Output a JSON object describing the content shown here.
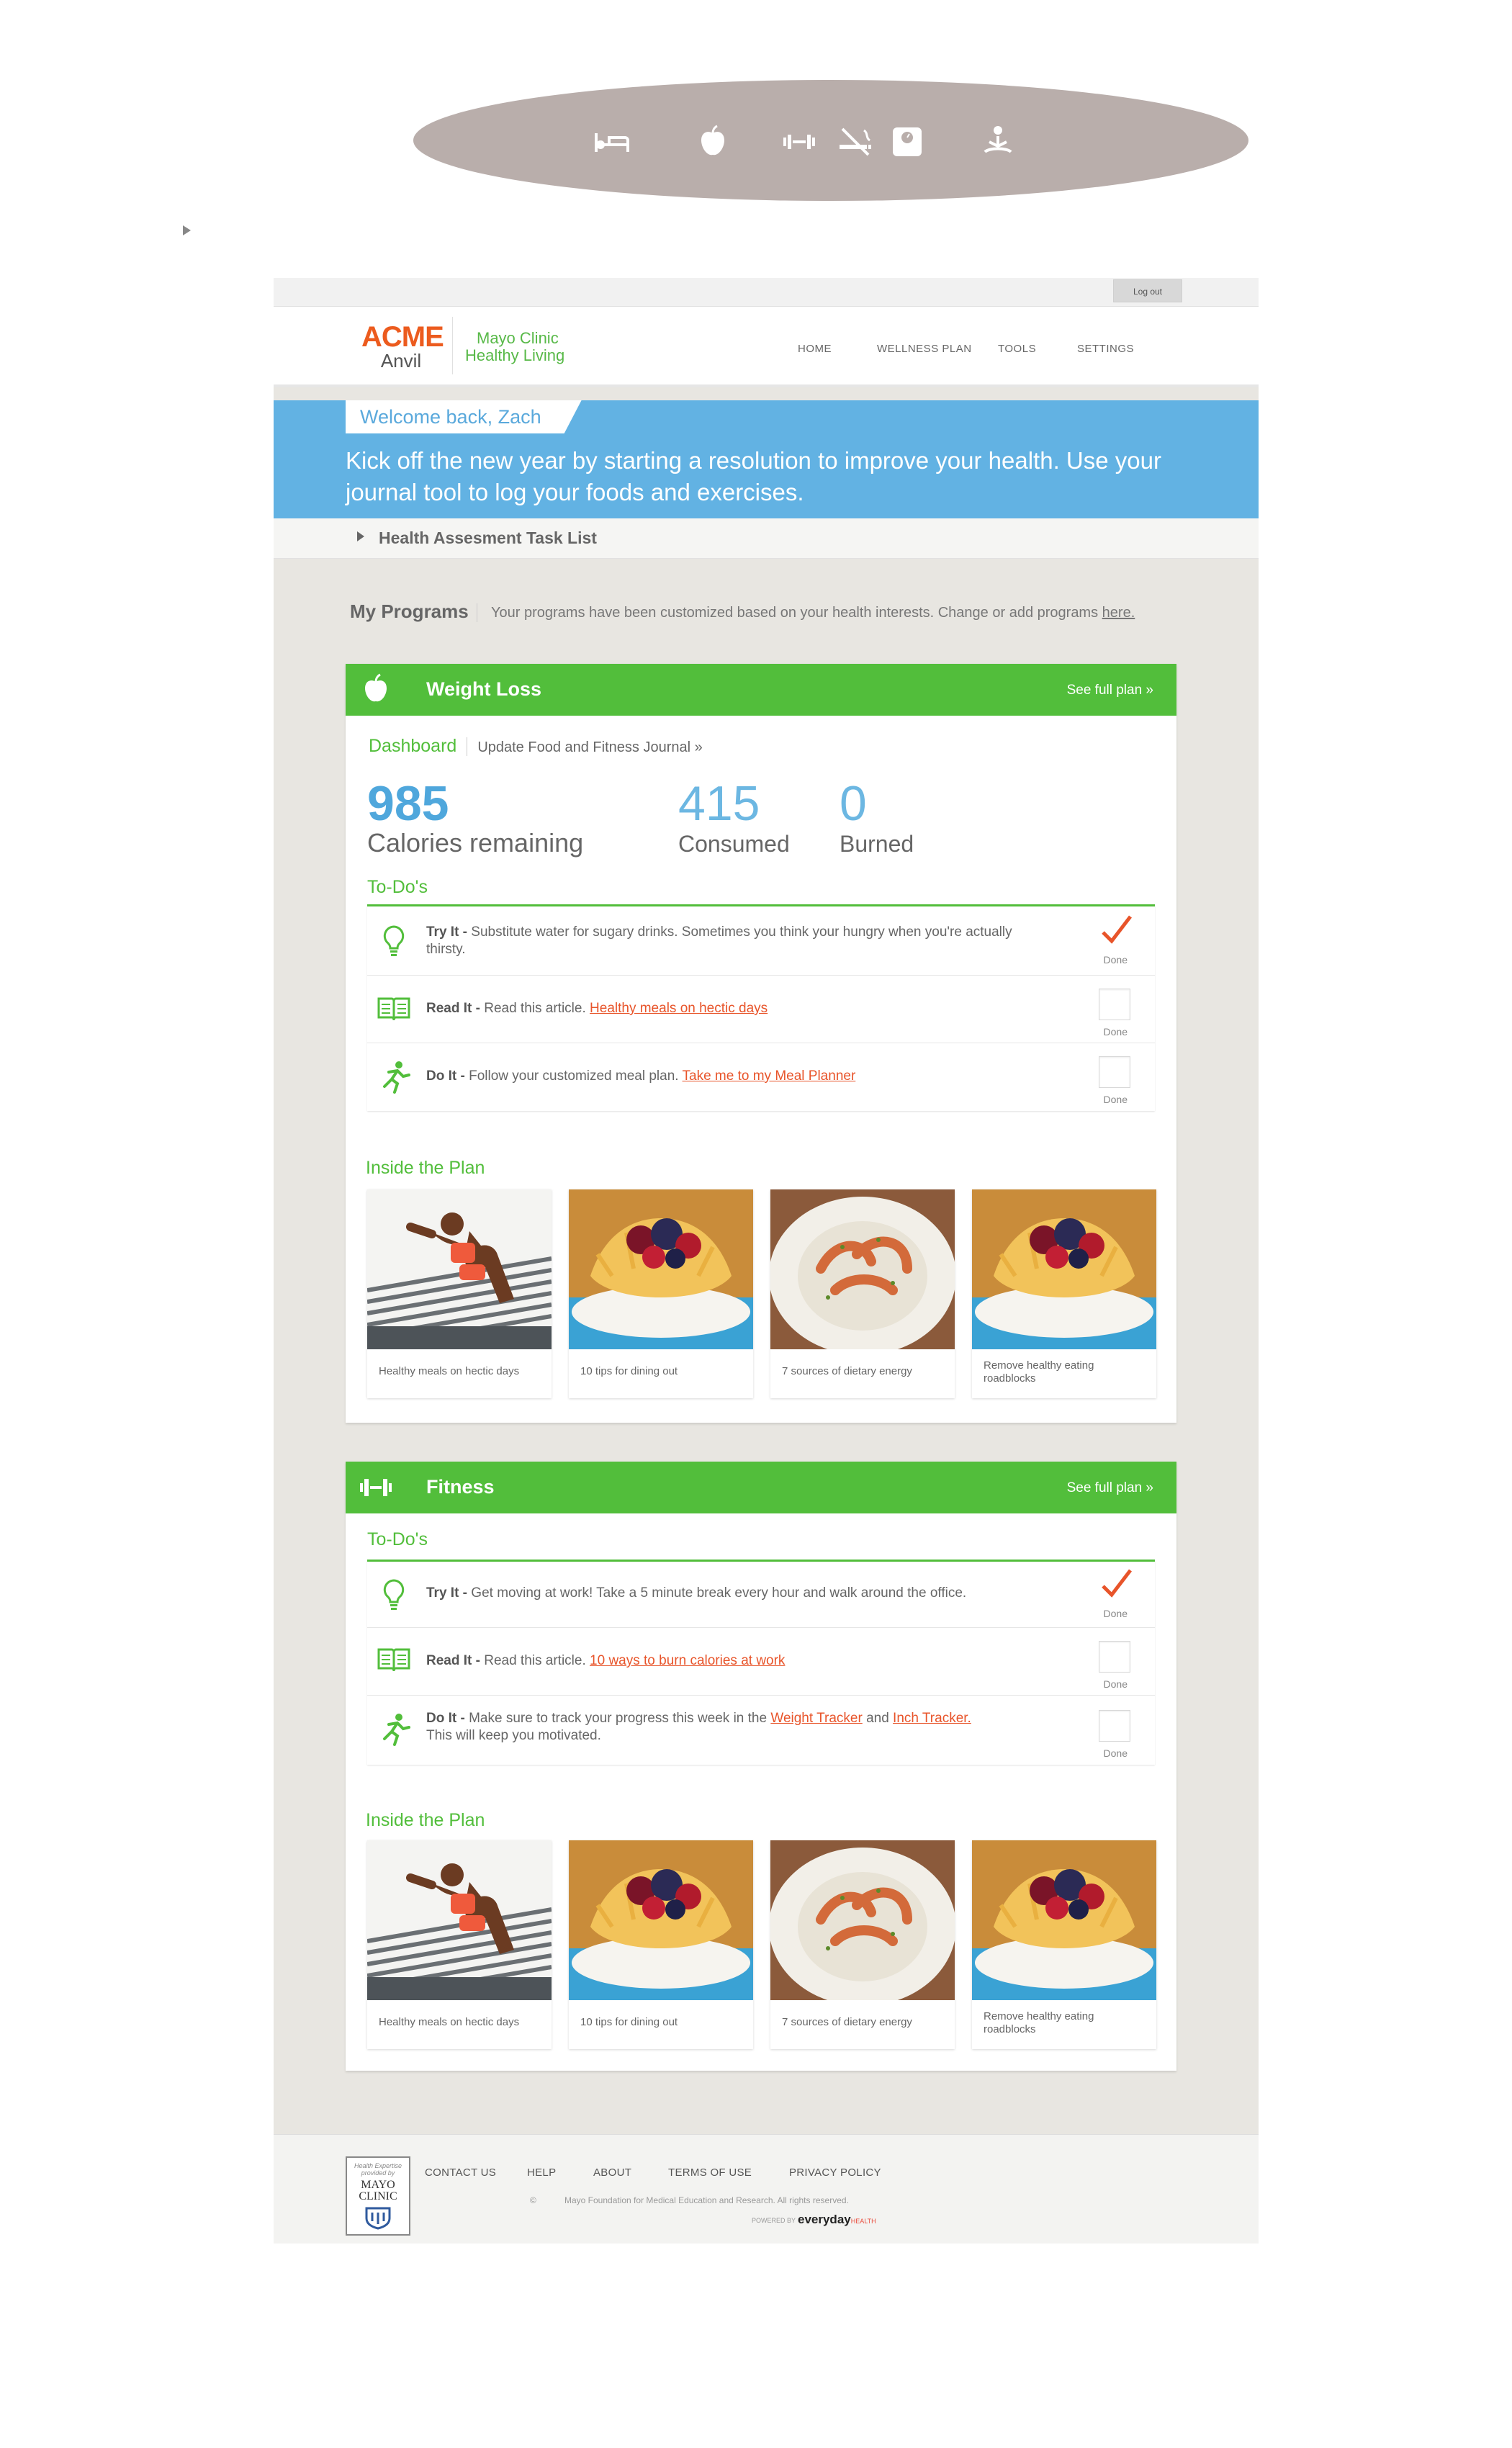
{
  "icon_bar": {
    "icons": [
      "bed-icon",
      "apple-icon",
      "dumbbell-icon",
      "no-smoking-icon",
      "scale-icon",
      "meditation-icon"
    ]
  },
  "top": {
    "logout": "Log out"
  },
  "brand": {
    "name": "ACME",
    "sub": "Anvil",
    "partner_line1": "Mayo Clinic",
    "partner_line2": "Healthy Living"
  },
  "nav": [
    "HOME",
    "WELLNESS PLAN",
    "TOOLS",
    "SETTINGS"
  ],
  "banner": {
    "welcome": "Welcome back, Zach",
    "message": "Kick off the new year by starting a resolution to improve your health. Use your journal tool to log your foods and exercises."
  },
  "task_list": "Health Assesment Task List",
  "programs": {
    "title": "My Programs",
    "desc": "Your programs have been customized based on your health interests. Change or add programs",
    "link": "here."
  },
  "weight_loss": {
    "title": "Weight Loss",
    "full_plan": "See full plan »",
    "tab_dashboard": "Dashboard",
    "tab_update": "Update Food and Fitness Journal »",
    "calories_remaining": "985",
    "calories_remaining_label": "Calories remaining",
    "consumed": "415",
    "consumed_label": "Consumed",
    "burned": "0",
    "burned_label": "Burned",
    "todos_title": "To-Do's",
    "todos": [
      {
        "kind": "Try It -",
        "text": "Substitute water for sugary drinks. Sometimes you think your hungry when you're actually thirsty.",
        "link": "",
        "done": true
      },
      {
        "kind": "Read It -",
        "text": "Read this article.",
        "link": "Healthy meals on hectic days",
        "done": false
      },
      {
        "kind": "Do It -",
        "text": "Follow your customized meal plan.",
        "link": "Take me to my Meal Planner",
        "done": false
      }
    ],
    "done_label": "Done",
    "inside_title": "Inside the Plan",
    "tiles": [
      "Healthy meals on hectic days",
      "10 tips for dining out",
      "7 sources of dietary energy",
      "Remove healthy eating roadblocks"
    ]
  },
  "fitness": {
    "title": "Fitness",
    "full_plan": "See full plan »",
    "todos_title": "To-Do's",
    "todo1_kind": "Try It -",
    "todo1_text": "Get moving at work! Take a 5 minute break every hour and walk around the office.",
    "todo2_kind": "Read It -",
    "todo2_text": "Read this article.",
    "todo2_link": "10 ways to burn calories at work",
    "todo3_kind": "Do It -",
    "todo3_text_a": "Make sure to track your progress this week in the",
    "todo3_link_a": "Weight Tracker",
    "todo3_text_b": "and",
    "todo3_link_b": "Inch Tracker.",
    "todo3_text_c": "This will keep you motivated.",
    "done_label": "Done",
    "inside_title": "Inside the Plan",
    "tiles": [
      "Healthy meals on hectic days",
      "10 tips for dining out",
      "7 sources of dietary energy",
      "Remove healthy eating roadblocks"
    ]
  },
  "footer": {
    "badge_line": "Health Expertise provided by",
    "badge_name": "MAYO CLINIC",
    "links": [
      "CONTACT US",
      "HELP",
      "ABOUT",
      "TERMS OF USE",
      "PRIVACY POLICY"
    ],
    "copyright_symbol": "©",
    "copyright": "Mayo Foundation for Medical Education and Research. All rights reserved.",
    "powered_by": "POWERED BY",
    "everyday": "everyday",
    "everyday_health": "HEALTH"
  },
  "colors": {
    "green": "#52be3b",
    "blue_banner": "#62b2e3",
    "orange": "#ec5b1e",
    "link": "#e8542a",
    "number_blue": "#4fa7dc"
  }
}
